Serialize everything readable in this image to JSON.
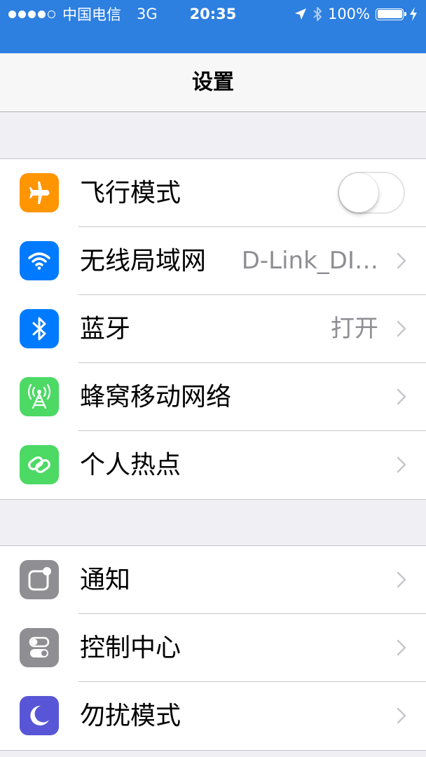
{
  "status_bar": {
    "carrier": "中国电信",
    "network": "3G",
    "time": "20:35",
    "battery": "100%",
    "bar_color": "#2d7fe0"
  },
  "nav": {
    "title": "设置"
  },
  "groups": [
    {
      "items": [
        {
          "label": "飞行模式",
          "icon": "airplane-icon",
          "icon_color": "#ff9500",
          "control": "toggle",
          "toggle_on": false
        },
        {
          "label": "无线局域网",
          "value": "D-Link_DI…",
          "icon": "wifi-icon",
          "icon_color": "#007aff",
          "control": "chevron"
        },
        {
          "label": "蓝牙",
          "value": "打开",
          "icon": "bluetooth-icon",
          "icon_color": "#007aff",
          "control": "chevron"
        },
        {
          "label": "蜂窝移动网络",
          "icon": "cellular-antenna-icon",
          "icon_color": "#4cd964",
          "control": "chevron"
        },
        {
          "label": "个人热点",
          "icon": "hotspot-chain-icon",
          "icon_color": "#4cd964",
          "control": "chevron"
        }
      ]
    },
    {
      "items": [
        {
          "label": "通知",
          "icon": "notifications-icon",
          "icon_color": "#8e8e93",
          "control": "chevron"
        },
        {
          "label": "控制中心",
          "icon": "control-center-icon",
          "icon_color": "#8e8e93",
          "control": "chevron"
        },
        {
          "label": "勿扰模式",
          "icon": "moon-icon",
          "icon_color": "#5856d6",
          "control": "chevron"
        }
      ]
    }
  ]
}
